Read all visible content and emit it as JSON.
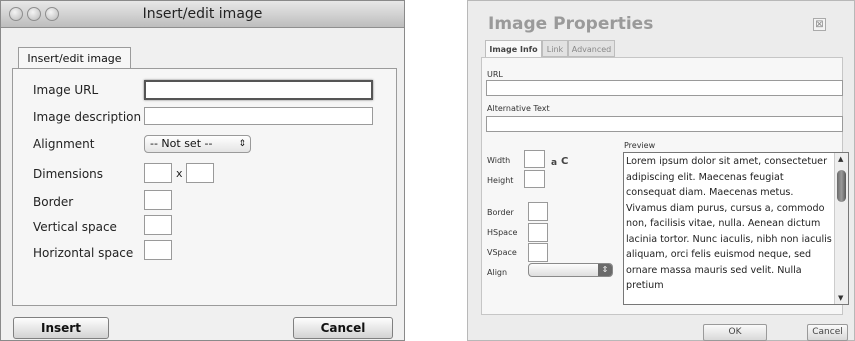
{
  "left_dialog": {
    "title": "Insert/edit image",
    "tab": "Insert/edit image",
    "fields": {
      "image_url": {
        "label": "Image URL",
        "value": ""
      },
      "image_description": {
        "label": "Image description",
        "value": ""
      },
      "alignment": {
        "label": "Alignment",
        "selected": "-- Not set --"
      },
      "dimensions": {
        "label": "Dimensions",
        "separator": "x",
        "width": "",
        "height": ""
      },
      "border": {
        "label": "Border",
        "value": ""
      },
      "vertical_space": {
        "label": "Vertical space",
        "value": ""
      },
      "horizontal_space": {
        "label": "Horizontal space",
        "value": ""
      }
    },
    "buttons": {
      "insert": "Insert",
      "cancel": "Cancel"
    }
  },
  "right_dialog": {
    "title": "Image Properties",
    "close_glyph": "⊠",
    "tabs": [
      "Image Info",
      "Link",
      "Advanced"
    ],
    "active_tab": "Image Info",
    "url_label": "URL",
    "alt_label": "Alternative Text",
    "width_label": "Width",
    "height_label": "Height",
    "lock_glyph": "a",
    "reset_glyph": "C",
    "border_label": "Border",
    "hspace_label": "HSpace",
    "vspace_label": "VSpace",
    "align_label": "Align",
    "preview_label": "Preview",
    "preview_text": "Lorem ipsum dolor sit amet, consectetuer adipiscing elit. Maecenas feugiat consequat diam. Maecenas metus. Vivamus diam purus, cursus a, commodo non, facilisis vitae, nulla. Aenean dictum lacinia tortor. Nunc iaculis, nibh non iaculis aliquam, orci felis euismod neque, sed ornare massa mauris sed velit. Nulla pretium",
    "buttons": {
      "ok": "OK",
      "cancel": "Cancel"
    }
  }
}
